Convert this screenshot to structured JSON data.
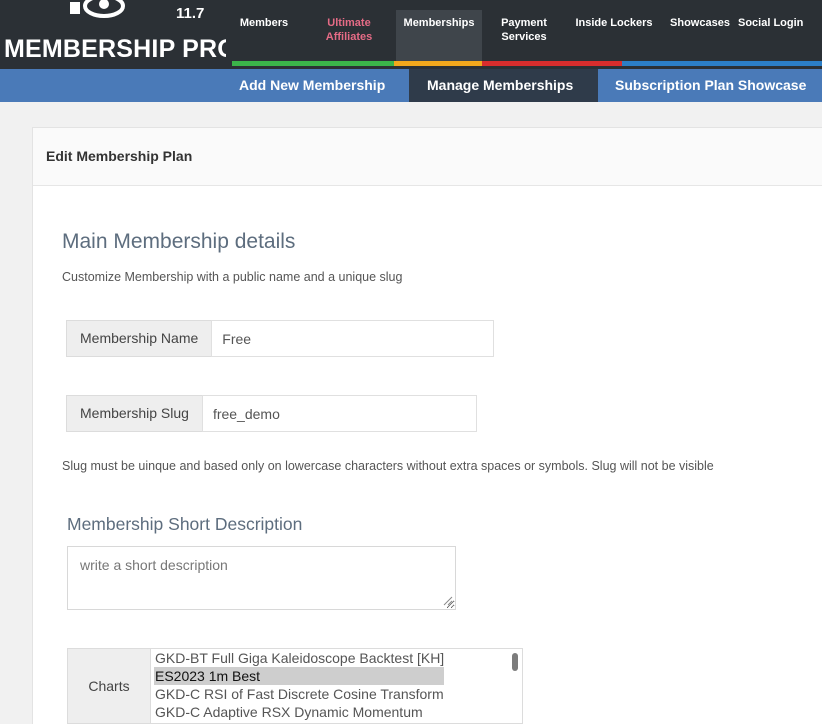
{
  "header": {
    "logo_text": "MEMBERSHIP PRO",
    "logo_version": "11.7",
    "nav": [
      {
        "label": "Members"
      },
      {
        "label_line1": "Ultimate",
        "label_line2": "Affiliates"
      },
      {
        "label": "Memberships"
      },
      {
        "label_line1": "Payment",
        "label_line2": "Services"
      },
      {
        "label": "Inside Lockers"
      },
      {
        "label": "Showcases"
      },
      {
        "label": "Social Login"
      }
    ],
    "colors": {
      "bar": "#2b3035",
      "affiliate_pink": "#e56b86",
      "subnav": "#4a7ab8"
    }
  },
  "subnav": {
    "items": [
      "Add New Membership",
      "Manage Memberships",
      "Subscription Plan Showcase"
    ],
    "active_index": 1
  },
  "panel": {
    "title": "Edit Membership Plan"
  },
  "main_details": {
    "heading": "Main Membership details",
    "description": "Customize Membership with a public name and a unique slug",
    "name_label": "Membership Name",
    "name_value": "Free",
    "slug_label": "Membership Slug",
    "slug_value": "free_demo",
    "slug_note": "Slug must be uinque and based only on lowercase characters without extra spaces or symbols. Slug will not be visible"
  },
  "short_description": {
    "heading": "Membership Short Description",
    "placeholder": "write a short description",
    "value": ""
  },
  "charts": {
    "label": "Charts",
    "options": [
      "GKD-BT Full Giga Kaleidoscope Backtest [KH]",
      "ES2023 1m Best",
      "GKD-C RSI of Fast Discrete Cosine Transform",
      "GKD-C Adaptive RSX Dynamic Momentum"
    ],
    "selected_index": 1
  }
}
